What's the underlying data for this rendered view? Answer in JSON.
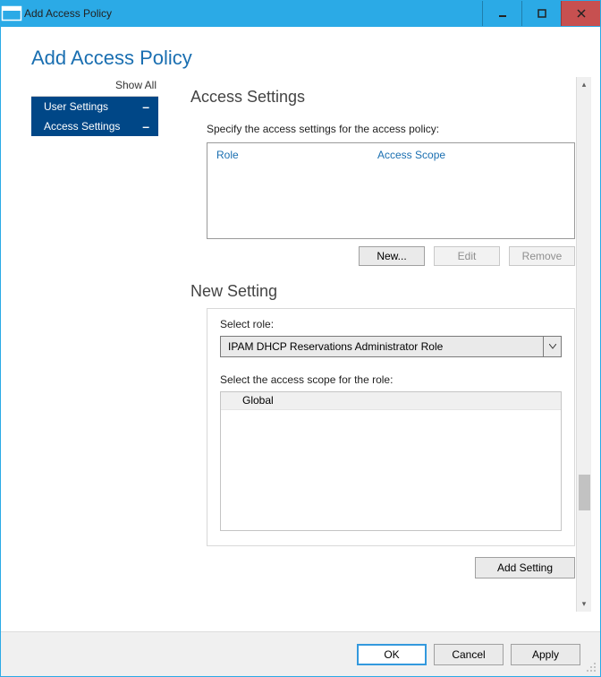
{
  "window": {
    "title": "Add Access Policy"
  },
  "heading": "Add Access Policy",
  "sidebar": {
    "show_all": "Show All",
    "items": [
      {
        "label": "User Settings",
        "toggle": "–"
      },
      {
        "label": "Access Settings",
        "toggle": "–"
      }
    ]
  },
  "access_settings": {
    "title": "Access Settings",
    "help": "Specify the access settings for the access policy:",
    "columns": {
      "role": "Role",
      "scope": "Access Scope"
    },
    "buttons": {
      "new": "New...",
      "edit": "Edit",
      "remove": "Remove"
    }
  },
  "new_setting": {
    "title": "New Setting",
    "role_label": "Select role:",
    "role_value": "IPAM DHCP Reservations Administrator Role",
    "scope_label": "Select the access scope for the role:",
    "scope_root": "Global",
    "add_button": "Add Setting"
  },
  "footer": {
    "ok": "OK",
    "cancel": "Cancel",
    "apply": "Apply"
  }
}
